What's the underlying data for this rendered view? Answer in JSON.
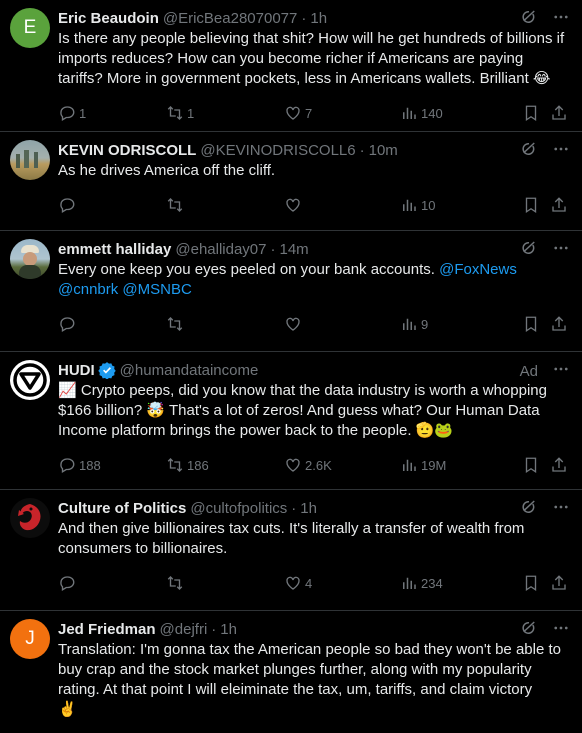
{
  "tweets": [
    {
      "name": "Eric Beaudoin",
      "handle": "@EricBea28070077",
      "time": "1h",
      "avatar_letter": "E",
      "avatar_color": "#5aa23c",
      "text": "Is there any people believing that shit? How will he get hundreds of billions if imports reduces? How can you become richer if Americans are paying tariffs? More in government pockets, less in Americans wallets. Brilliant",
      "emoji_end": "😂",
      "replies": "1",
      "retweets": "1",
      "likes": "7",
      "views": "140"
    },
    {
      "name": "KEVIN ODRISCOLL",
      "handle": "@KEVINODRISCOLL6",
      "time": "10m",
      "text": "As he drives America off the cliff.",
      "replies": "",
      "retweets": "",
      "likes": "",
      "views": "10"
    },
    {
      "name": "emmett halliday",
      "handle": "@ehalliday07",
      "time": "14m",
      "text_pre": "Every one keep you eyes peeled on your bank accounts. ",
      "mention1": "@FoxNews",
      "mention2": "@cnnbrk",
      "mention3": "@MSNBC",
      "replies": "",
      "retweets": "",
      "likes": "",
      "views": "9"
    },
    {
      "name": "HUDI",
      "handle": "@humandataincome",
      "ad_label": "Ad",
      "emoji_start": "📈",
      "text_a": " Crypto peeps, did you know that the data industry is worth a whopping $166 billion? ",
      "emoji_mid": "🤯",
      "text_b": " That's a lot of zeros! And guess what? Our Human Data Income platform brings the power back to the people. ",
      "emoji_end": "🫡🐸",
      "replies": "188",
      "retweets": "186",
      "likes": "2.6K",
      "views": "19M"
    },
    {
      "name": "Culture of Politics",
      "handle": "@cultofpolitics",
      "time": "1h",
      "text": "And then give billionaires tax cuts. It's literally a transfer of wealth from consumers to billionaires.",
      "replies": "",
      "retweets": "",
      "likes": "4",
      "views": "234"
    },
    {
      "name": "Jed Friedman",
      "handle": "@dejfri",
      "time": "1h",
      "avatar_letter": "J",
      "avatar_color": "#f2710f",
      "text": "Translation: I'm gonna tax the American people so bad they won't be able to buy crap and the stock market plunges further, along with my popularity rating. At that point I will eleiminate the tax, um, tariffs, and claim victory",
      "emoji_end": "✌️"
    }
  ]
}
